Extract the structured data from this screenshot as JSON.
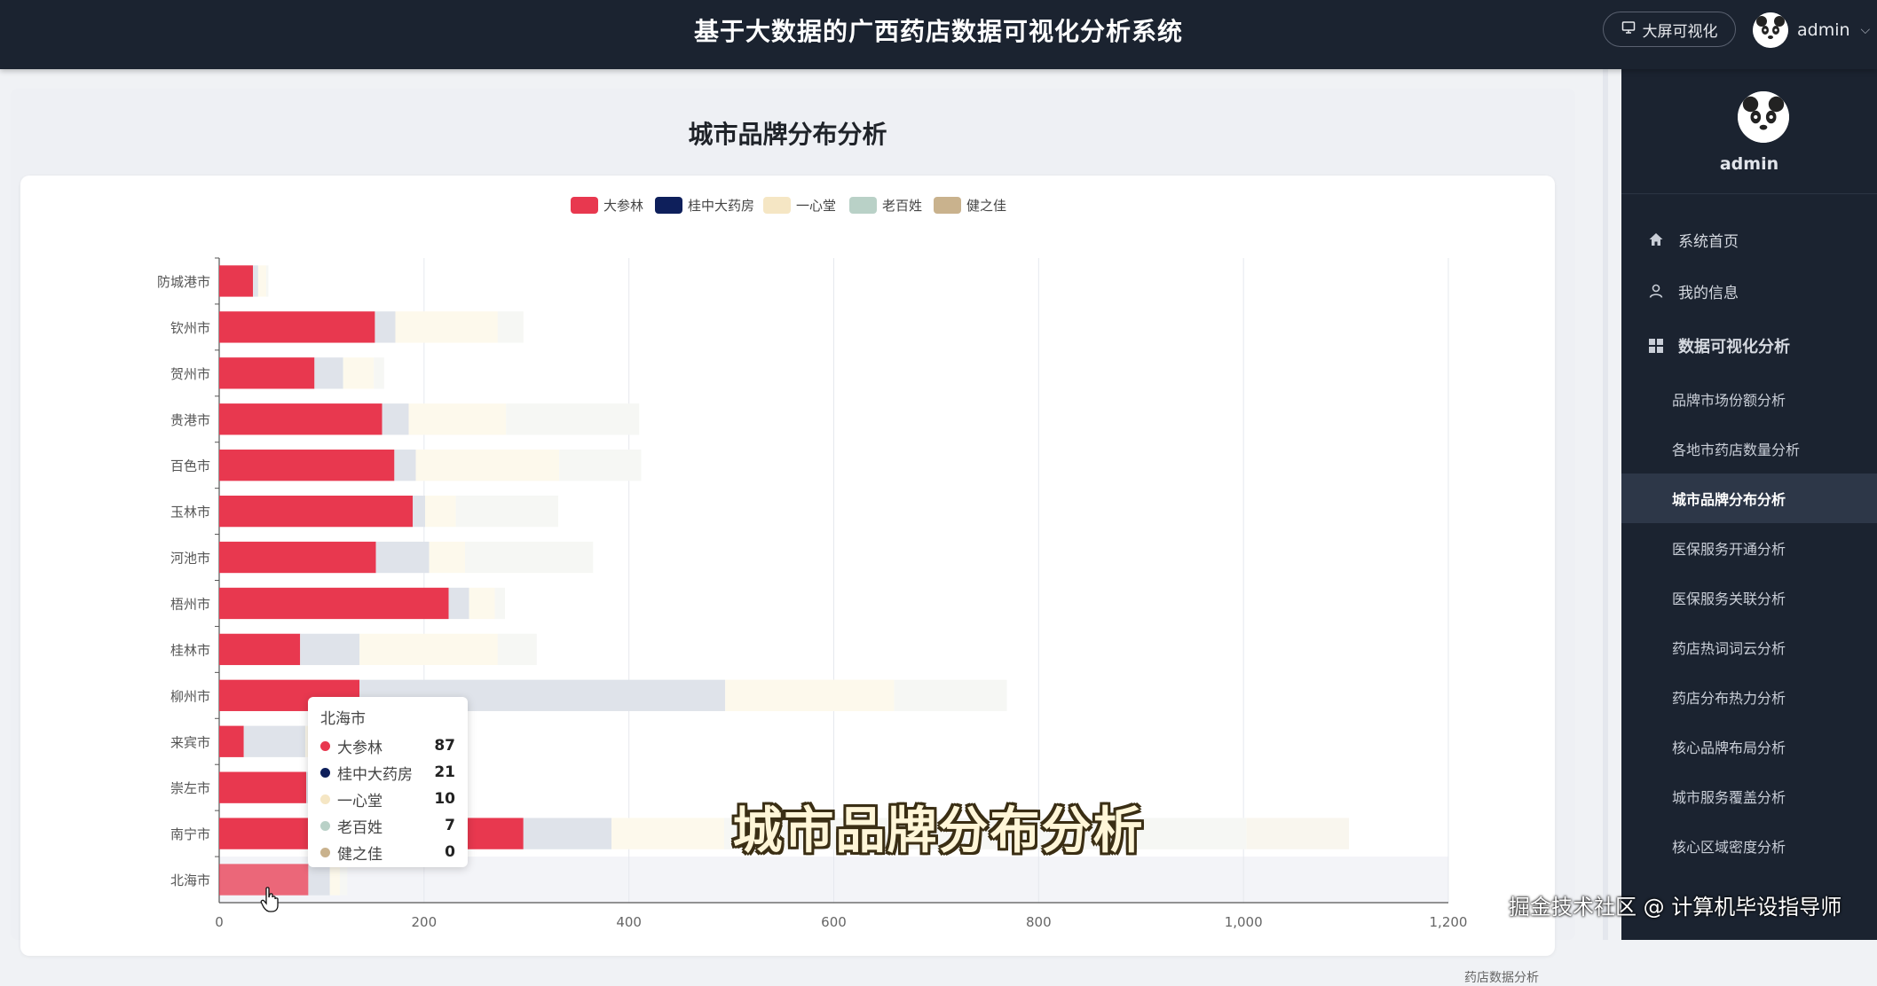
{
  "header": {
    "system_title": "基于大数据的广西药店数据可视化分析系统",
    "bigscreen_label": "大屏可视化",
    "user_name": "admin"
  },
  "sidebar": {
    "user_name": "admin",
    "menu": [
      {
        "label": "系统首页",
        "icon": "home-icon"
      },
      {
        "label": "我的信息",
        "icon": "user-icon"
      },
      {
        "label": "数据可视化分析",
        "icon": "grid-icon"
      }
    ],
    "sub_items": [
      "品牌市场份额分析",
      "各地市药店数量分析",
      "城市品牌分布分析",
      "医保服务开通分析",
      "医保服务关联分析",
      "药店热词词云分析",
      "药店分布热力分析",
      "核心品牌布局分析",
      "城市服务覆盖分析",
      "核心区域密度分析"
    ],
    "active_sub": "城市品牌分布分析"
  },
  "main": {
    "page_title": "城市品牌分布分析",
    "footer_text": "药店数据分析"
  },
  "tooltip": {
    "title": "北海市",
    "rows": [
      {
        "name": "大参林",
        "value": "87",
        "color": "#e8384f"
      },
      {
        "name": "桂中大药房",
        "value": "21",
        "color": "#0e1f5b"
      },
      {
        "name": "一心堂",
        "value": "10",
        "color": "#f5e6c4"
      },
      {
        "name": "老百姓",
        "value": "7",
        "color": "#b9d1c7"
      },
      {
        "name": "健之佳",
        "value": "0",
        "color": "#c9b28d"
      }
    ]
  },
  "overlay": {
    "subtitle": "城市品牌分布分析",
    "watermark": "掘金技术社区 @ 计算机毕设指导师"
  },
  "colors": {
    "topbar_bg": "#1b2330",
    "sidebar_bg": "#1b2330",
    "accent_red": "#e8384f",
    "navy": "#0e1f5b",
    "cream": "#f5e6c4",
    "sage": "#b9d1c7",
    "tan": "#c9b28d"
  },
  "chart_data": {
    "type": "bar",
    "orientation": "horizontal",
    "stacked": true,
    "categories": [
      "防城港市",
      "钦州市",
      "贺州市",
      "贵港市",
      "百色市",
      "玉林市",
      "河池市",
      "梧州市",
      "桂林市",
      "柳州市",
      "来宾市",
      "崇左市",
      "南宁市",
      "北海市"
    ],
    "series": [
      {
        "name": "大参林",
        "color": "#e8384f",
        "values": [
          33,
          152,
          93,
          159,
          171,
          189,
          153,
          224,
          79,
          137,
          24,
          85,
          297,
          87
        ]
      },
      {
        "name": "桂中大药房",
        "color": "#0e1f5b",
        "values": [
          5,
          20,
          28,
          26,
          21,
          12,
          52,
          20,
          58,
          357,
          60,
          40,
          86,
          21
        ]
      },
      {
        "name": "一心堂",
        "color": "#f5e6c4",
        "values": [
          8,
          100,
          30,
          95,
          140,
          30,
          35,
          25,
          135,
          165,
          45,
          45,
          110,
          10
        ]
      },
      {
        "name": "老百姓",
        "color": "#b9d1c7",
        "values": [
          2,
          25,
          10,
          130,
          80,
          100,
          125,
          10,
          38,
          110,
          15,
          20,
          510,
          7
        ]
      },
      {
        "name": "健之佳",
        "color": "#c9b28d",
        "values": [
          0,
          0,
          0,
          0,
          0,
          0,
          0,
          0,
          0,
          0,
          0,
          0,
          100,
          0
        ]
      }
    ],
    "xlim": [
      0,
      1200
    ],
    "x_ticks": [
      "0",
      "200",
      "400",
      "600",
      "800",
      "1,000",
      "1,200"
    ],
    "legend_position": "top-center",
    "highlighted_category": "北海市"
  }
}
